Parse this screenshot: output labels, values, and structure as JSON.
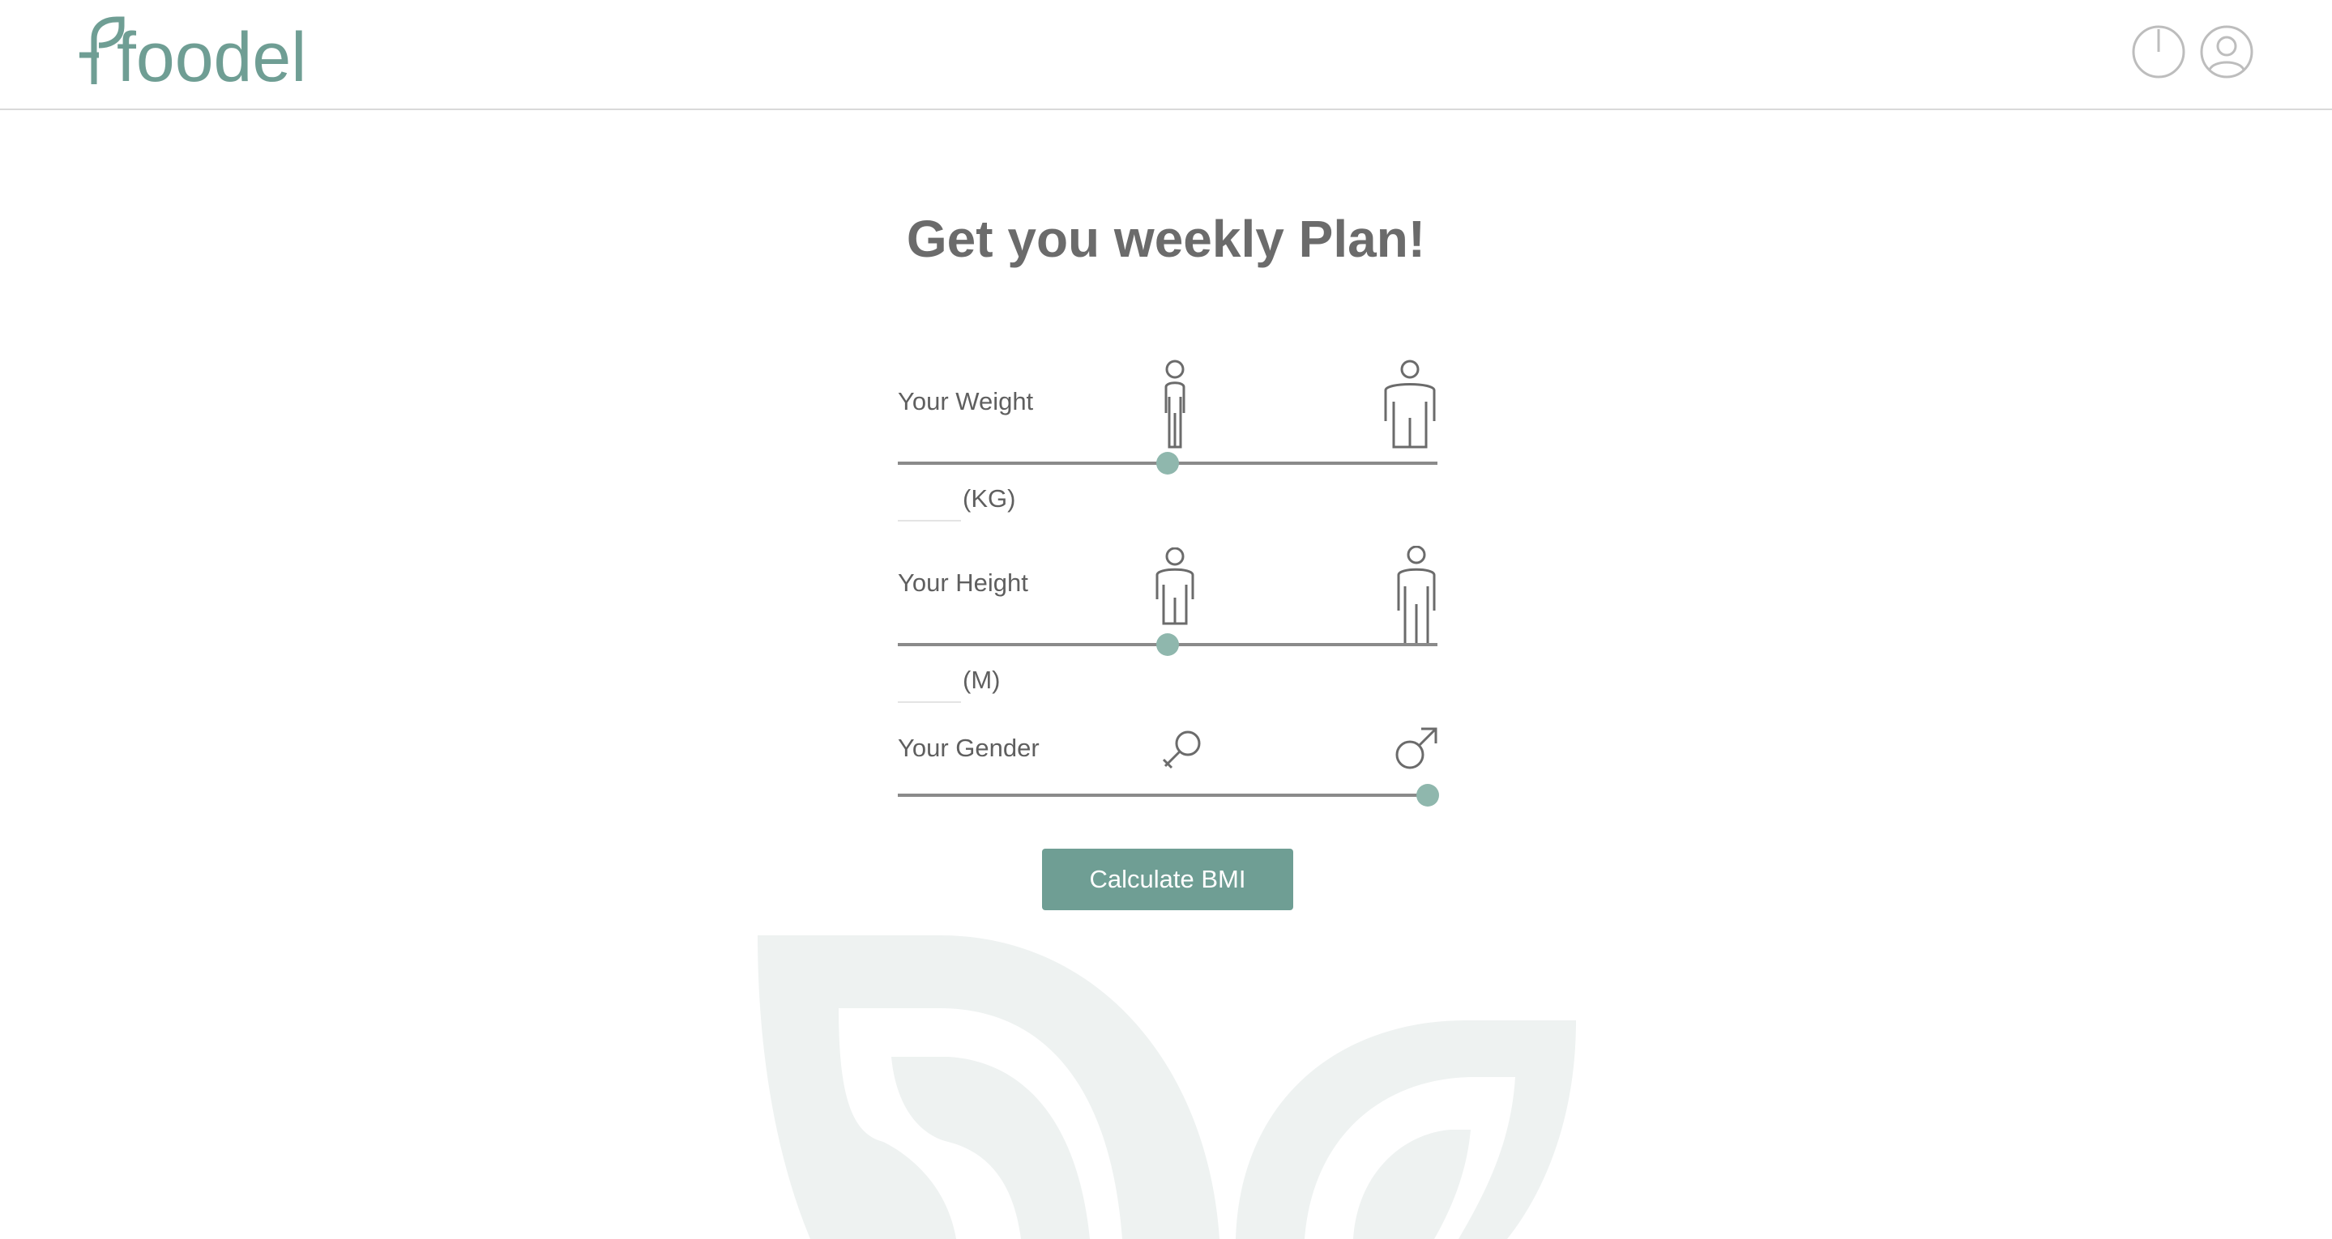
{
  "header": {
    "logo_text": "foodel",
    "logo_icon": "leaf-icon",
    "power_icon": "power-icon",
    "user_icon": "user-circle-icon"
  },
  "main": {
    "title": "Get you weekly Plan!",
    "weight": {
      "label": "Your Weight",
      "unit": "(KG)",
      "value": "",
      "slider_fraction": 0.5,
      "icons": [
        "thin-person-icon",
        "wide-person-icon"
      ]
    },
    "height": {
      "label": "Your Height",
      "unit": "(M)",
      "value": "",
      "slider_fraction": 0.5,
      "icons": [
        "short-person-icon",
        "tall-person-icon"
      ]
    },
    "gender": {
      "label": "Your Gender",
      "slider_fraction": 0.98,
      "icons": [
        "female-symbol-icon",
        "male-symbol-icon"
      ]
    },
    "calculate_button": "Calculate BMI"
  },
  "colors": {
    "brand": "#6f9e94",
    "slider_thumb": "#8fb7ad",
    "text": "#5f5f5f",
    "watermark": "#eef2f1"
  }
}
